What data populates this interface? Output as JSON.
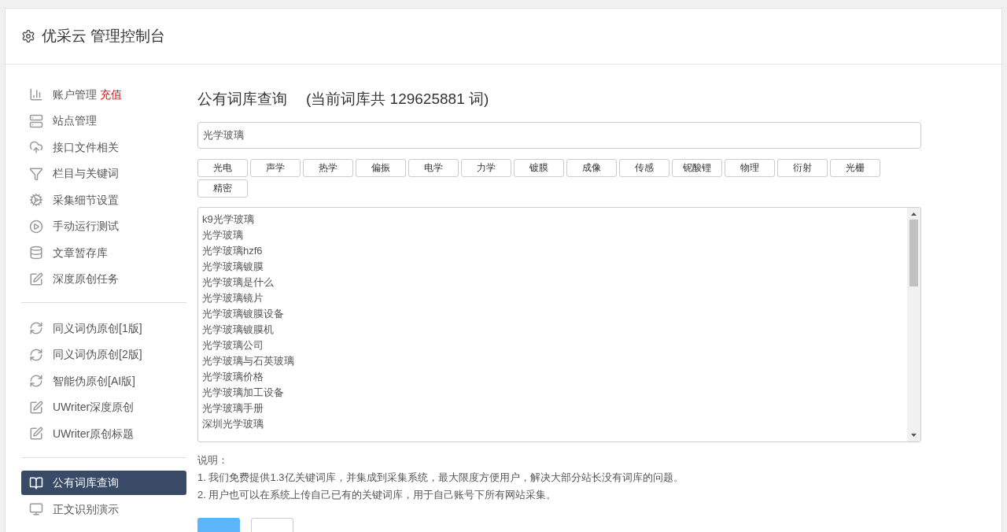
{
  "header": {
    "title": "优采云 管理控制台"
  },
  "sidebar": {
    "groups": [
      [
        {
          "label": "账户管理",
          "badge": "充值",
          "selected": false
        },
        {
          "label": "站点管理",
          "selected": false
        },
        {
          "label": "接口文件相关",
          "selected": false
        },
        {
          "label": "栏目与关键词",
          "selected": false
        },
        {
          "label": "采集细节设置",
          "selected": false
        },
        {
          "label": "手动运行测试",
          "selected": false
        },
        {
          "label": "文章暂存库",
          "selected": false
        },
        {
          "label": "深度原创任务",
          "selected": false
        }
      ],
      [
        {
          "label": "同义词伪原创[1版]",
          "selected": false
        },
        {
          "label": "同义词伪原创[2版]",
          "selected": false
        },
        {
          "label": "智能伪原创[AI版]",
          "selected": false
        },
        {
          "label": "UWriter深度原创",
          "selected": false
        },
        {
          "label": "UWriter原创标题",
          "selected": false
        }
      ],
      [
        {
          "label": "公有词库查询",
          "selected": true
        },
        {
          "label": "正文识别演示",
          "selected": false
        }
      ]
    ]
  },
  "main": {
    "title": "公有词库查询",
    "subtitle": "(当前词库共 129625881 词)",
    "search": {
      "value": "光学玻璃"
    },
    "tags": [
      "光电",
      "声学",
      "热学",
      "偏振",
      "电学",
      "力学",
      "镀膜",
      "成像",
      "传感",
      "铌酸锂",
      "物理",
      "衍射",
      "光栅",
      "精密"
    ],
    "results": [
      "k9光学玻璃",
      "光学玻璃",
      "光学玻璃hzf6",
      "光学玻璃镀膜",
      "光学玻璃是什么",
      "光学玻璃镜片",
      "光学玻璃镀膜设备",
      "光学玻璃镀膜机",
      "光学玻璃公司",
      "光学玻璃与石英玻璃",
      "光学玻璃价格",
      "光学玻璃加工设备",
      "光学玻璃手册",
      "深圳光学玻璃"
    ],
    "notes_title": "说明：",
    "notes": [
      "1. 我们免费提供1.3亿关键词库，并集成到采集系统，最大限度方便用户，解决大部分站长没有词库的问题。",
      "2. 用户也可以在系统上传自己已有的关键词库，用于自己账号下所有网站采集。"
    ],
    "buttons": [
      {
        "kind": "primary"
      },
      {
        "kind": "default"
      }
    ]
  }
}
